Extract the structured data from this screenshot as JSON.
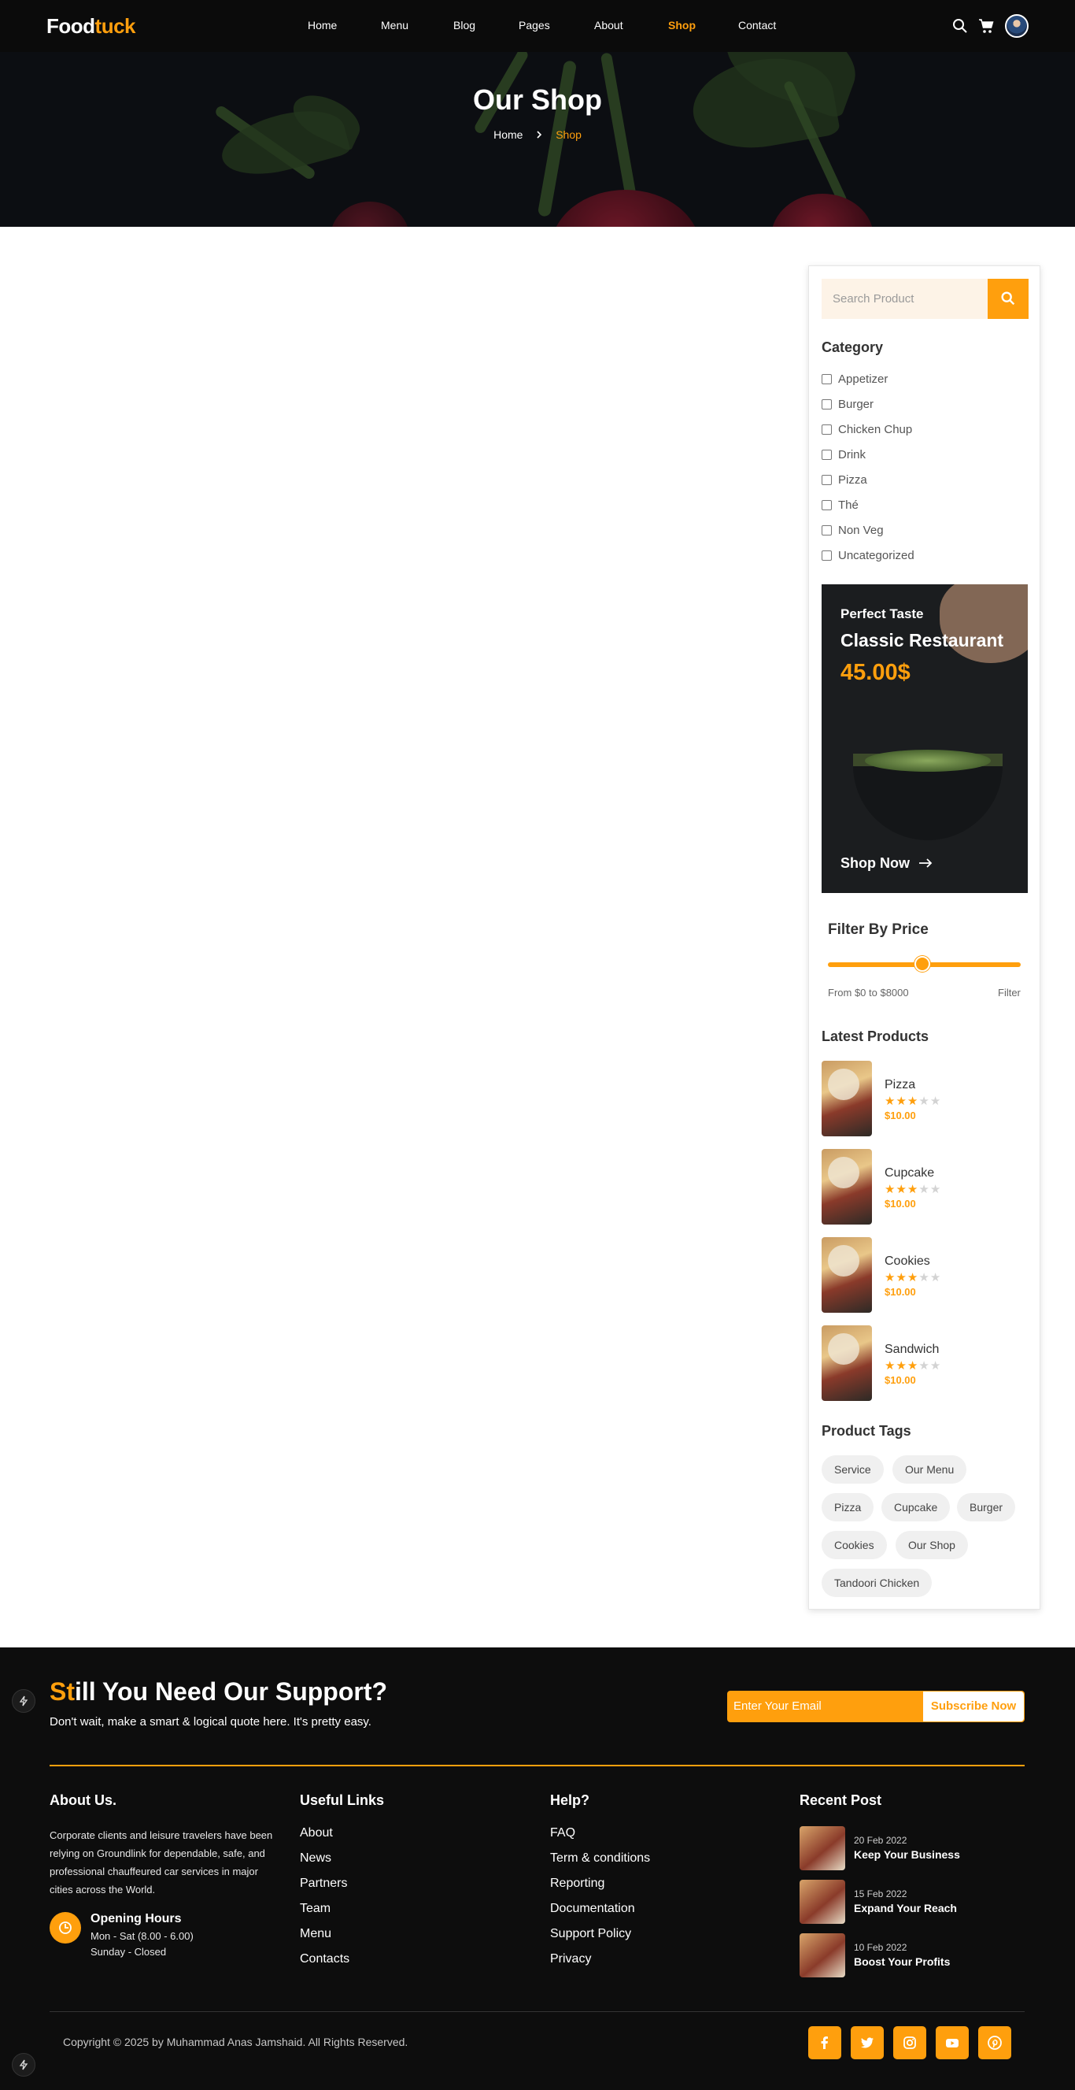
{
  "nav": {
    "logo_main": "Food",
    "logo_accent": "tuck",
    "links": [
      "Home",
      "Menu",
      "Blog",
      "Pages",
      "About",
      "Shop",
      "Contact"
    ],
    "active": "Shop"
  },
  "hero": {
    "title": "Our Shop",
    "breadcrumb_home": "Home",
    "breadcrumb_current": "Shop"
  },
  "sidebar": {
    "search_placeholder": "Search Product",
    "category_heading": "Category",
    "categories": [
      "Appetizer",
      "Burger",
      "Chicken Chup",
      "Drink",
      "Pizza",
      "Thé",
      "Non Veg",
      "Uncategorized"
    ],
    "promo": {
      "subtitle": "Perfect Taste",
      "title": "Classic Restaurant",
      "price": "45.00$",
      "cta": "Shop Now"
    },
    "filter": {
      "heading": "Filter By Price",
      "range_text": "From $0 to $8000",
      "button": "Filter",
      "slider_fraction": 0.49
    },
    "latest_heading": "Latest Products",
    "latest": [
      {
        "name": "Pizza",
        "price": "$10.00",
        "rating": 3
      },
      {
        "name": "Cupcake",
        "price": "$10.00",
        "rating": 3
      },
      {
        "name": "Cookies",
        "price": "$10.00",
        "rating": 3
      },
      {
        "name": "Sandwich",
        "price": "$10.00",
        "rating": 3
      }
    ],
    "tags_heading": "Product Tags",
    "tags": [
      "Service",
      "Our Menu",
      "Pizza",
      "Cupcake",
      "Burger",
      "Cookies",
      "Our Shop",
      "Tandoori Chicken"
    ]
  },
  "footer": {
    "support_accent": "St",
    "support_rest": "ill You Need Our Support?",
    "support_sub": "Don't wait, make a smart & logical quote here. It's pretty easy.",
    "email_placeholder": "Enter Your Email",
    "subscribe": "Subscribe Now",
    "about": {
      "heading": "About Us.",
      "text": "Corporate clients and leisure travelers have been relying on Groundlink for dependable, safe, and professional chauffeured car services in major cities across the World.",
      "hours_heading": "Opening Hours",
      "hours_1": "Mon - Sat (8.00 - 6.00)",
      "hours_2": "Sunday - Closed"
    },
    "useful": {
      "heading": "Useful Links",
      "links": [
        "About",
        "News",
        "Partners",
        "Team",
        "Menu",
        "Contacts"
      ]
    },
    "help": {
      "heading": "Help?",
      "links": [
        "FAQ",
        "Term & conditions",
        "Reporting",
        "Documentation",
        "Support Policy",
        "Privacy"
      ]
    },
    "recent": {
      "heading": "Recent Post",
      "posts": [
        {
          "date": "20 Feb 2022",
          "title": "Keep Your Business"
        },
        {
          "date": "15 Feb 2022",
          "title": "Expand Your Reach"
        },
        {
          "date": "10 Feb 2022",
          "title": "Boost Your Profits"
        }
      ]
    },
    "copyright": "Copyright © 2025 by Muhammad Anas Jamshaid. All Rights Reserved.",
    "social": [
      "facebook-icon",
      "twitter-icon",
      "instagram-icon",
      "youtube-icon",
      "pinterest-icon"
    ]
  },
  "colors": {
    "accent": "#ff9f0d",
    "dark": "#0d0d0d"
  }
}
